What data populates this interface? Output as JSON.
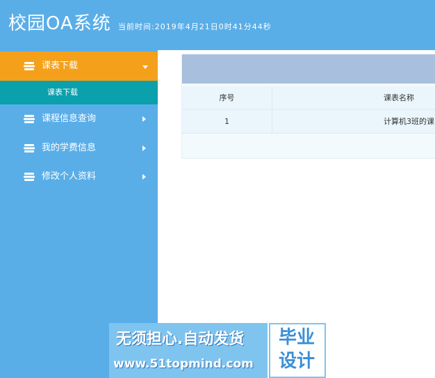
{
  "header": {
    "title": "校园OA系统",
    "clock": "当前时间:2019年4月21日0时41分44秒"
  },
  "sidebar": {
    "items": [
      {
        "label": "课表下载",
        "icon": "book-stack-icon",
        "expanded": true,
        "children": [
          {
            "label": "课表下载"
          }
        ]
      },
      {
        "label": "课程信息查询",
        "icon": "book-stack-icon",
        "expanded": false
      },
      {
        "label": "我的学费信息",
        "icon": "book-stack-icon",
        "expanded": false
      },
      {
        "label": "修改个人资料",
        "icon": "book-stack-icon",
        "expanded": false
      }
    ]
  },
  "table": {
    "columns": [
      "序号",
      "课表名称"
    ],
    "rows": [
      [
        "1",
        "计算机3班的课"
      ]
    ]
  },
  "watermark": {
    "line1": "无须担心.自动发货",
    "line2": "www.51topmind.com",
    "box_line1": "毕业",
    "box_line2": "设计"
  },
  "colors": {
    "header_bg": "#5aaee8",
    "active_item": "#f5a01a",
    "sub_item": "#0aa0ac",
    "panel_head": "#a8c0de"
  }
}
